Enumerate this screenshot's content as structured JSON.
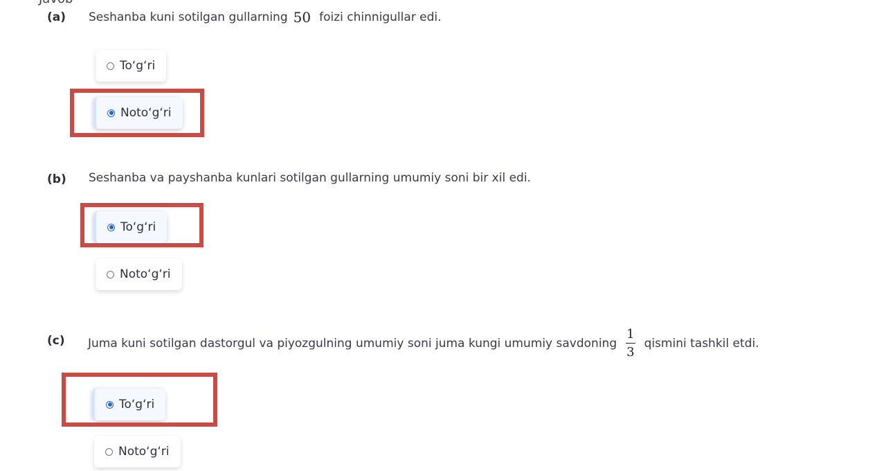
{
  "section_heading": "Javob",
  "colors": {
    "highlight_box": "#cc4a42",
    "radio_selected": "#1a66e0"
  },
  "questions": [
    {
      "letter": "(a)",
      "text_before": "Seshanba kuni sotilgan gullarning",
      "math": "50",
      "text_after": "foizi chinnigullar edi.",
      "options": [
        {
          "label": "To‘g‘ri",
          "selected": false
        },
        {
          "label": "Noto‘g‘ri",
          "selected": true
        }
      ]
    },
    {
      "letter": "(b)",
      "text": "Seshanba va payshanba kunlari sotilgan gullarning umumiy soni bir xil edi.",
      "options": [
        {
          "label": "To‘g‘ri",
          "selected": true
        },
        {
          "label": "Noto‘g‘ri",
          "selected": false
        }
      ]
    },
    {
      "letter": "(c)",
      "text_before": "Juma kuni sotilgan dastorgul va piyozgulning umumiy soni juma kungi umumiy savdoning",
      "fraction": {
        "numerator": "1",
        "denominator": "3"
      },
      "text_after": "qismini tashkil etdi.",
      "options": [
        {
          "label": "To‘g‘ri",
          "selected": true
        },
        {
          "label": "Noto‘g‘ri",
          "selected": false
        }
      ]
    }
  ]
}
